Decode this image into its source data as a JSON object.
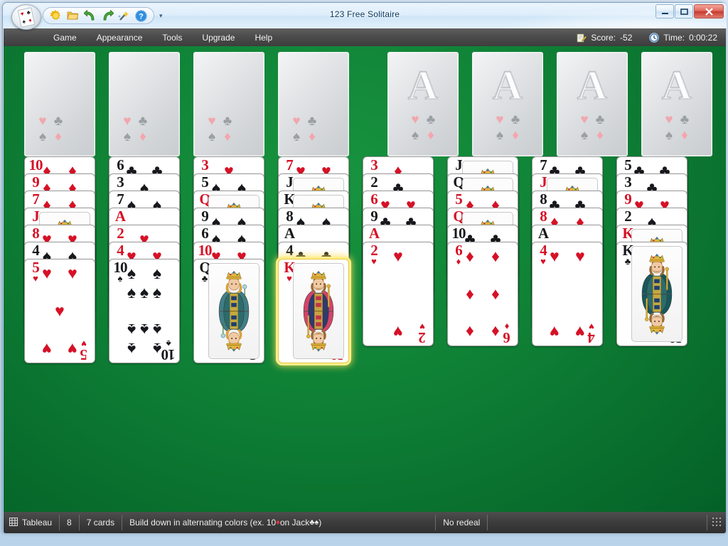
{
  "window": {
    "title": "123 Free Solitaire",
    "buttons": {
      "minimize": "—",
      "maximize": "❐",
      "close": "✕"
    }
  },
  "toolbar": {
    "orb": "orb-card-button",
    "items": [
      {
        "name": "new-game-icon",
        "glyph": "☀"
      },
      {
        "name": "open-folder-icon",
        "glyph": "📁"
      },
      {
        "name": "undo-icon",
        "glyph": "↰"
      },
      {
        "name": "redo-icon",
        "glyph": "↱"
      },
      {
        "name": "hint-wand-icon",
        "glyph": "✨"
      },
      {
        "name": "help-icon",
        "glyph": "?"
      }
    ],
    "more": "▾"
  },
  "menu": {
    "items": [
      "Game",
      "Appearance",
      "Tools",
      "Upgrade",
      "Help"
    ]
  },
  "stats": {
    "score_label": "Score:",
    "score_value": "-52",
    "time_label": "Time:",
    "time_value": "0:00:22"
  },
  "freecells": [
    {
      "name": "freecell-1",
      "empty": true
    },
    {
      "name": "freecell-2",
      "empty": true
    },
    {
      "name": "freecell-3",
      "empty": true
    },
    {
      "name": "freecell-4",
      "empty": true
    }
  ],
  "foundations": [
    {
      "name": "foundation-1",
      "placeholder": "A",
      "empty": true
    },
    {
      "name": "foundation-2",
      "placeholder": "A",
      "empty": true
    },
    {
      "name": "foundation-3",
      "placeholder": "A",
      "empty": true
    },
    {
      "name": "foundation-4",
      "placeholder": "A",
      "empty": true
    }
  ],
  "tableau": [
    {
      "name": "tableau-column-1",
      "cards": [
        {
          "rank": "10",
          "suit": "d"
        },
        {
          "rank": "9",
          "suit": "d"
        },
        {
          "rank": "7",
          "suit": "d"
        },
        {
          "rank": "J",
          "suit": "d"
        },
        {
          "rank": "8",
          "suit": "h"
        },
        {
          "rank": "4",
          "suit": "s"
        },
        {
          "rank": "5",
          "suit": "h"
        }
      ]
    },
    {
      "name": "tableau-column-2",
      "cards": [
        {
          "rank": "6",
          "suit": "c"
        },
        {
          "rank": "3",
          "suit": "s"
        },
        {
          "rank": "7",
          "suit": "s"
        },
        {
          "rank": "A",
          "suit": "h"
        },
        {
          "rank": "2",
          "suit": "h"
        },
        {
          "rank": "4",
          "suit": "h"
        },
        {
          "rank": "10",
          "suit": "s"
        }
      ]
    },
    {
      "name": "tableau-column-3",
      "cards": [
        {
          "rank": "3",
          "suit": "h"
        },
        {
          "rank": "5",
          "suit": "s"
        },
        {
          "rank": "Q",
          "suit": "d"
        },
        {
          "rank": "9",
          "suit": "s"
        },
        {
          "rank": "6",
          "suit": "s"
        },
        {
          "rank": "10",
          "suit": "h"
        },
        {
          "rank": "Q",
          "suit": "c"
        }
      ]
    },
    {
      "name": "tableau-column-4",
      "cards": [
        {
          "rank": "7",
          "suit": "h"
        },
        {
          "rank": "J",
          "suit": "c"
        },
        {
          "rank": "K",
          "suit": "s"
        },
        {
          "rank": "8",
          "suit": "s"
        },
        {
          "rank": "A",
          "suit": "s"
        },
        {
          "rank": "4",
          "suit": "c"
        },
        {
          "rank": "K",
          "suit": "h",
          "selected": true
        }
      ]
    },
    {
      "name": "tableau-column-5",
      "cards": [
        {
          "rank": "3",
          "suit": "d"
        },
        {
          "rank": "2",
          "suit": "c"
        },
        {
          "rank": "6",
          "suit": "h"
        },
        {
          "rank": "9",
          "suit": "c"
        },
        {
          "rank": "A",
          "suit": "d"
        },
        {
          "rank": "2",
          "suit": "h"
        }
      ]
    },
    {
      "name": "tableau-column-6",
      "cards": [
        {
          "rank": "J",
          "suit": "s"
        },
        {
          "rank": "Q",
          "suit": "s"
        },
        {
          "rank": "5",
          "suit": "d"
        },
        {
          "rank": "Q",
          "suit": "h"
        },
        {
          "rank": "10",
          "suit": "c"
        },
        {
          "rank": "6",
          "suit": "d"
        }
      ]
    },
    {
      "name": "tableau-column-7",
      "cards": [
        {
          "rank": "7",
          "suit": "c"
        },
        {
          "rank": "J",
          "suit": "h"
        },
        {
          "rank": "8",
          "suit": "c"
        },
        {
          "rank": "8",
          "suit": "d"
        },
        {
          "rank": "A",
          "suit": "c"
        },
        {
          "rank": "4",
          "suit": "h"
        }
      ]
    },
    {
      "name": "tableau-column-8",
      "cards": [
        {
          "rank": "5",
          "suit": "c"
        },
        {
          "rank": "3",
          "suit": "c"
        },
        {
          "rank": "9",
          "suit": "h"
        },
        {
          "rank": "2",
          "suit": "s"
        },
        {
          "rank": "K",
          "suit": "d"
        },
        {
          "rank": "K",
          "suit": "c"
        }
      ]
    }
  ],
  "statusbar": {
    "pile_name": "Tableau",
    "pile_count": "8",
    "cards_text": "7 cards",
    "rule_text_pre": "Build down in alternating colors (ex. 10 ",
    "rule_suit_1": "♦",
    "rule_text_mid": " on Jack ",
    "rule_suit_2": "♣♠",
    "rule_text_post": ")",
    "redeal_text": "No redeal"
  },
  "colors": {
    "felt_green": "#0f8136",
    "menu_dark": "#4a4a4a",
    "red_suit": "#d61126",
    "black_suit": "#16181c",
    "highlight": "#ffef8a",
    "close_red": "#c9392f"
  }
}
